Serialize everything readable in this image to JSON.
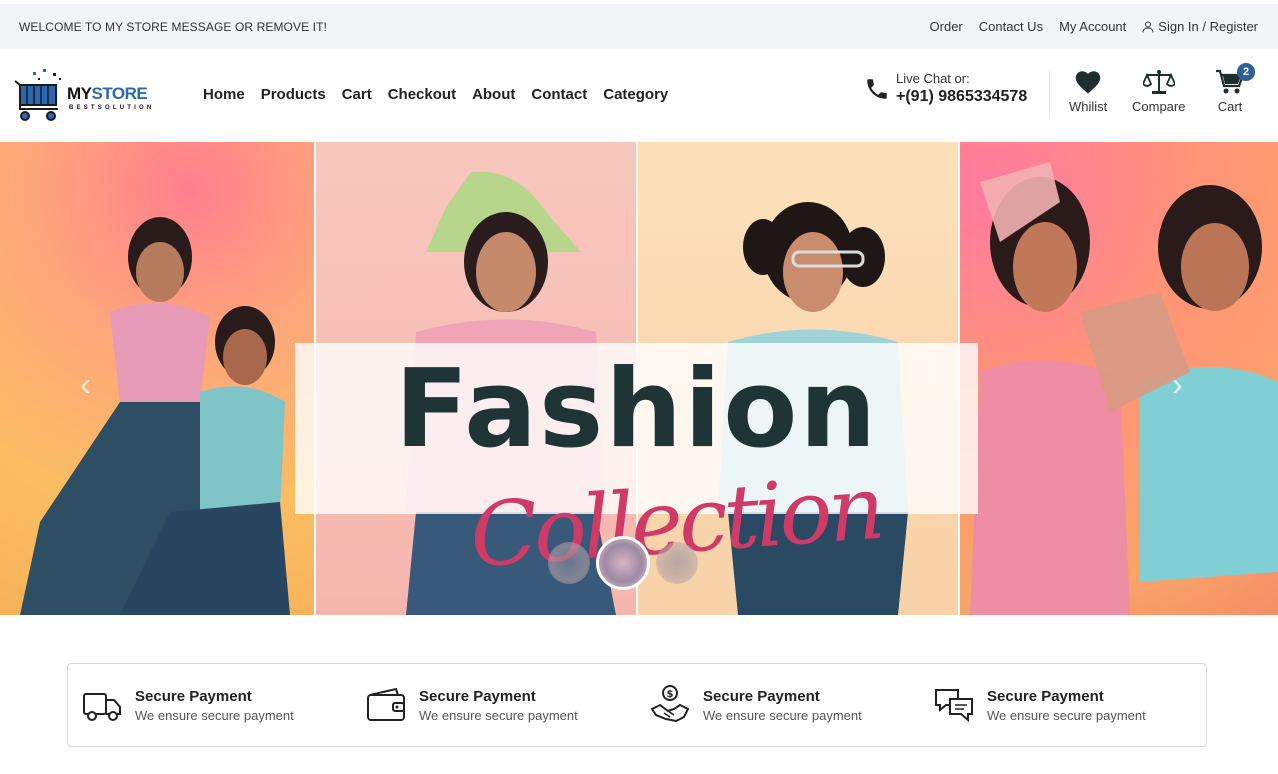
{
  "topbar": {
    "welcome": "WELCOME TO MY STORE MESSAGE OR REMOVE IT!",
    "links": [
      "Order",
      "Contact Us",
      "My Account"
    ],
    "signin": "Sign In / Register"
  },
  "logo": {
    "brand_my": "MY",
    "brand_store": "STORE",
    "tagline": "BESTSOLUTION"
  },
  "nav": [
    "Home",
    "Products",
    "Cart",
    "Checkout",
    "About",
    "Contact",
    "Category"
  ],
  "contact": {
    "label": "Live Chat or:",
    "phone": "+(91) 9865334578"
  },
  "header_icons": {
    "wishlist": "Whilist",
    "compare": "Compare",
    "cart": "Cart",
    "cart_count": "2"
  },
  "hero": {
    "title": "Fashion",
    "subtitle": "Collection",
    "active_slide": 2
  },
  "features": [
    {
      "icon": "truck-icon",
      "title": "Secure Payment",
      "subtitle": "We ensure secure payment"
    },
    {
      "icon": "wallet-icon",
      "title": "Secure Payment",
      "subtitle": "We ensure secure payment"
    },
    {
      "icon": "handshake-dollar-icon",
      "title": "Secure Payment",
      "subtitle": "We ensure secure payment"
    },
    {
      "icon": "chat-bubbles-icon",
      "title": "Secure Payment",
      "subtitle": "We ensure secure payment"
    }
  ],
  "colors": {
    "accent_blue": "#2c67b3",
    "collection_pink": "#cf3a66",
    "title_dark": "#1f3535",
    "badge": "#2d5f9a"
  }
}
